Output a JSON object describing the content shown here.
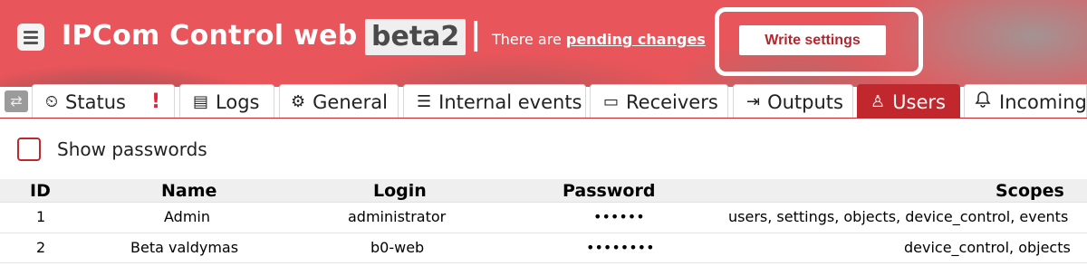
{
  "header": {
    "title": "IPCom Control web",
    "version_badge": "beta2",
    "separator": "|",
    "pending_prefix": "There are ",
    "pending_link": "pending changes",
    "write_button": "Write settings"
  },
  "tabs": [
    {
      "label": "Status",
      "icon": "gauge-icon",
      "glyph": "⏲",
      "alert": "!"
    },
    {
      "label": "Logs",
      "icon": "log-icon",
      "glyph": "▤"
    },
    {
      "label": "General",
      "icon": "gear-icon",
      "glyph": "⚙"
    },
    {
      "label": "Internal events",
      "icon": "checklist-icon",
      "glyph": "☰"
    },
    {
      "label": "Receivers",
      "icon": "receiver-icon",
      "glyph": "▭"
    },
    {
      "label": "Outputs",
      "icon": "output-icon",
      "glyph": "⇥"
    },
    {
      "label": "Users",
      "icon": "user-icon",
      "glyph": "♙",
      "active": true
    },
    {
      "label": "Incoming",
      "icon": "bell-icon",
      "glyph": "🔔"
    }
  ],
  "show_passwords": {
    "label": "Show passwords",
    "checked": false
  },
  "users_table": {
    "columns": [
      "ID",
      "Name",
      "Login",
      "Password",
      "Scopes"
    ],
    "rows": [
      {
        "id": "1",
        "name": "Admin",
        "login": "administrator",
        "password": "••••••",
        "scopes": "users, settings, objects, device_control, events"
      },
      {
        "id": "2",
        "name": "Beta valdymas",
        "login": "b0-web",
        "password": "••••••••",
        "scopes": "device_control, objects"
      }
    ]
  },
  "colors": {
    "accent": "#c0282e",
    "header_bg": "#e8555a"
  }
}
